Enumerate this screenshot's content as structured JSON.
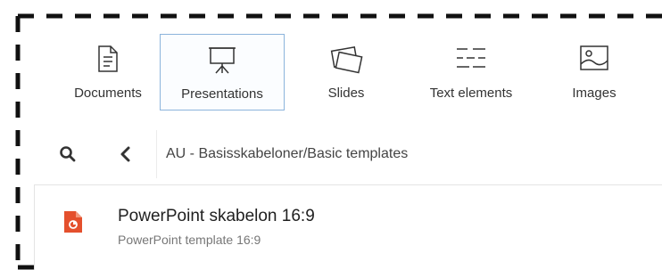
{
  "tabs": [
    {
      "label": "Documents",
      "icon": "document-icon",
      "active": false
    },
    {
      "label": "Presentations",
      "icon": "presentation-board-icon",
      "active": true
    },
    {
      "label": "Slides",
      "icon": "slides-stack-icon",
      "active": false
    },
    {
      "label": "Text elements",
      "icon": "text-lines-icon",
      "active": false
    },
    {
      "label": "Images",
      "icon": "image-icon",
      "active": false
    }
  ],
  "navigation": {
    "search_icon": "search-icon",
    "back_icon": "chevron-left-icon",
    "breadcrumb": "AU - Basisskabeloner/Basic templates"
  },
  "items": [
    {
      "title": "PowerPoint skabelon 16:9",
      "subtitle": "PowerPoint template 16:9",
      "icon": "powerpoint-file-icon"
    }
  ],
  "colors": {
    "active_border": "#8cb4dc",
    "powerpoint_orange": "#e4502d",
    "frame_dash": "#111111"
  }
}
